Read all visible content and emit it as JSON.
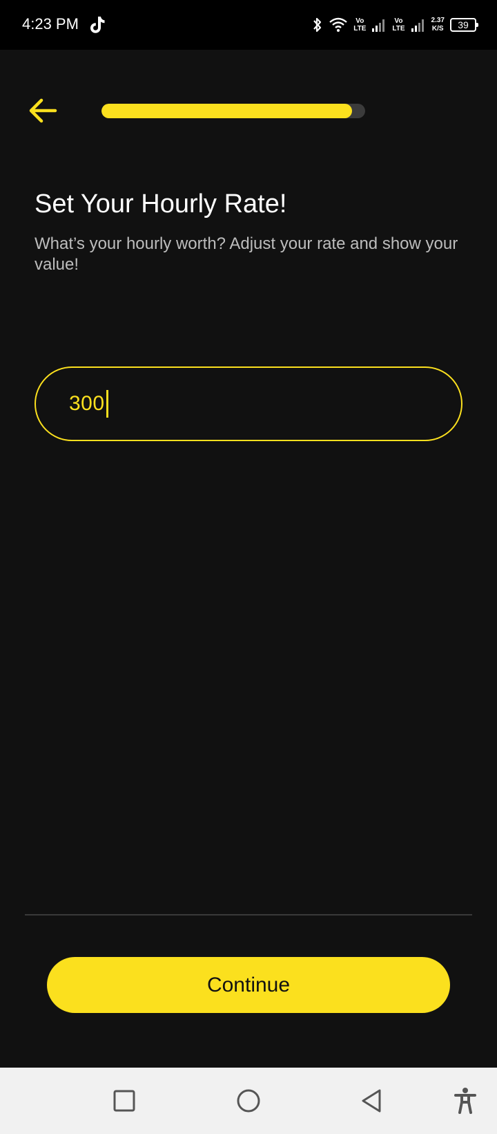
{
  "status_bar": {
    "time": "4:23 PM",
    "network_1": "Vo\nLTE",
    "network_2": "Vo\nLTE",
    "speed_value": "2.37",
    "speed_unit": "K/S",
    "battery": "39",
    "icons": [
      "tiktok-icon",
      "bluetooth-icon",
      "wifi-icon",
      "signal-icon",
      "signal-icon",
      "battery-icon"
    ]
  },
  "header": {
    "back_icon": "arrow-left-icon",
    "progress": 0.95
  },
  "main": {
    "title": "Set Your Hourly Rate!",
    "subtitle": "What’s your hourly worth? Adjust your rate and show your value!",
    "rate_input": {
      "value": "300"
    }
  },
  "footer": {
    "continue_label": "Continue"
  },
  "nav_bar": {
    "icons": [
      "recents-square-icon",
      "home-circle-icon",
      "back-triangle-icon",
      "accessibility-icon"
    ]
  },
  "colors": {
    "background": "#111111",
    "accent": "#fbe01e",
    "text_primary": "#ffffff",
    "text_secondary": "#bdbdbd",
    "progress_track": "#3b3b3b",
    "nav_bar": "#f1f1f1"
  }
}
